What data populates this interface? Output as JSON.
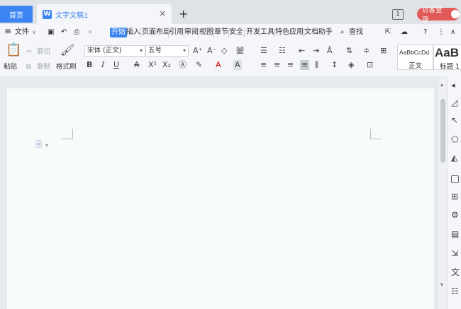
{
  "titlebar": {
    "home_tab": "首页",
    "doc_tab": "文字文稿1",
    "doc_icon": "W",
    "close": "×",
    "new_tab": "+",
    "tab_count": "1",
    "login": "访客登录"
  },
  "menu": {
    "file": "文件",
    "tabs": [
      "开始",
      "插入",
      "页面布局",
      "引用",
      "审阅",
      "视图",
      "章节",
      "安全",
      "开发工具",
      "特色应用",
      "文档助手"
    ],
    "search": "查找",
    "help": "?"
  },
  "ribbon": {
    "paste": "粘贴",
    "cut": "剪切",
    "copy": "复制",
    "format_painter": "格式刷",
    "font_name": "宋体 (正文)",
    "font_size": "五号",
    "style_normal_preview": "AaBbCcDd",
    "style_normal": "正文",
    "style_heading_preview": "AaB",
    "style_heading": "标题 1"
  },
  "colors": {
    "accent": "#3c84f2",
    "login_bg": "#e05a5a",
    "page_bg": "#f7fbf9"
  }
}
